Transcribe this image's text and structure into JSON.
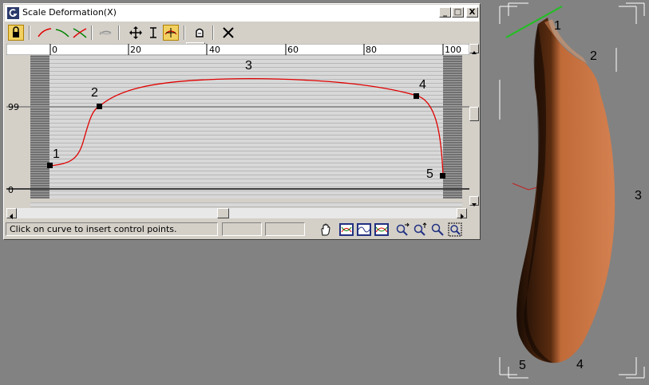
{
  "window": {
    "title": "Scale Deformation(X)",
    "minimize": "_",
    "maximize": "□",
    "close": "X"
  },
  "toolbar": {
    "buttons": [
      "make-symmetrical",
      "display-x-axis",
      "display-y-axis",
      "display-xy-axes",
      "swap-curves",
      "move-control-point",
      "scale-control-point",
      "insert-corner-point",
      "delete-control-point",
      "reset-curve"
    ],
    "active": "insert-corner-point",
    "flyout": [
      "insert-corner-point",
      "insert-bezier-point"
    ]
  },
  "graph": {
    "ruler_ticks": [
      "0",
      "20",
      "40",
      "60",
      "80",
      "100"
    ],
    "y_labels": [
      "99",
      "0"
    ],
    "point_labels": [
      "1",
      "2",
      "3",
      "4",
      "5"
    ],
    "curve_color": "#e00000"
  },
  "status": {
    "prompt": "Click on curve to insert control points.",
    "field1": "",
    "field2": ""
  },
  "nav_buttons": [
    "pan-icon",
    "zoom-extents-icon",
    "zoom-horizontal-extents-icon",
    "zoom-vertical-extents-icon",
    "zoom-horizontal-icon",
    "zoom-vertical-icon",
    "zoom-icon",
    "zoom-region-icon"
  ],
  "viewport": {
    "labels": [
      "1",
      "2",
      "3",
      "4",
      "5"
    ],
    "object": "banana-shaped loft object",
    "object_color": "#c87040"
  }
}
